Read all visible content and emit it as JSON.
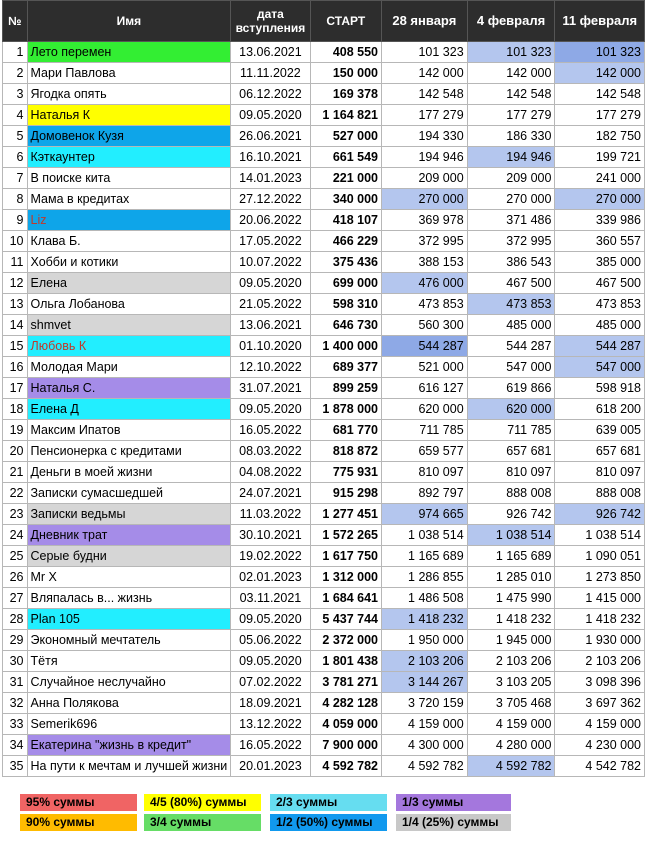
{
  "colors": {
    "green": "#33ee33",
    "yellow": "#ffff00",
    "blue": "#0ea5e9",
    "cyan": "#22eeff",
    "purple": "#a58ce8",
    "gray": "#d6d6d6",
    "lightblue": "#b4c6ee",
    "midblue": "#8ea9e6",
    "red": "#f06464",
    "orange": "#ffbb00",
    "legendgreen": "#66dd66",
    "legendcyan": "#66ddf0",
    "legendblue": "#1199ee",
    "legendpurple": "#a477dd",
    "legendgray": "#c8c8c8"
  },
  "headers": {
    "num": "№",
    "name": "Имя",
    "date": "дата вступления",
    "start": "СТАРТ",
    "w1": "28 января",
    "w2": "4 февраля",
    "w3": "11 февраля"
  },
  "rows": [
    {
      "n": "1",
      "name": "Лето перемен",
      "date": "13.06.2021",
      "start": "408 550",
      "w1": "101 323",
      "w2": "101 323",
      "w3": "101 323",
      "nc": "green",
      "c2": "lightblue",
      "c3": "midblue"
    },
    {
      "n": "2",
      "name": "Мари Павлова",
      "date": "11.11.2022",
      "start": "150 000",
      "w1": "142 000",
      "w2": "142 000",
      "w3": "142 000",
      "c3": "lightblue"
    },
    {
      "n": "3",
      "name": "Ягодка опять",
      "date": "06.12.2022",
      "start": "169 378",
      "w1": "142 548",
      "w2": "142 548",
      "w3": "142 548"
    },
    {
      "n": "4",
      "name": "Наталья К",
      "date": "09.05.2020",
      "start": "1 164 821",
      "w1": "177 279",
      "w2": "177 279",
      "w3": "177 279",
      "nc": "yellow"
    },
    {
      "n": "5",
      "name": "Домовенок Кузя",
      "date": "26.06.2021",
      "start": "527 000",
      "w1": "194 330",
      "w2": "186 330",
      "w3": "182 750",
      "nc": "blue"
    },
    {
      "n": "6",
      "name": "Кэткаунтер",
      "date": "16.10.2021",
      "start": "661 549",
      "w1": "194 946",
      "w2": "194 946",
      "w3": "199 721",
      "nc": "cyan",
      "c2": "lightblue"
    },
    {
      "n": "7",
      "name": "В поиске кита",
      "date": "14.01.2023",
      "start": "221 000",
      "w1": "209 000",
      "w2": "209 000",
      "w3": "241 000"
    },
    {
      "n": "8",
      "name": "Мама в кредитах",
      "date": "27.12.2022",
      "start": "340 000",
      "w1": "270 000",
      "w2": "270 000",
      "w3": "270 000",
      "c1": "lightblue",
      "c3": "lightblue"
    },
    {
      "n": "9",
      "name": "Liz",
      "date": "20.06.2022",
      "start": "418 107",
      "w1": "369 978",
      "w2": "371 486",
      "w3": "339 986",
      "nc": "blue",
      "ntext": "#c0392b"
    },
    {
      "n": "10",
      "name": "Клава Б.",
      "date": "17.05.2022",
      "start": "466 229",
      "w1": "372 995",
      "w2": "372 995",
      "w3": "360 557"
    },
    {
      "n": "11",
      "name": "Хобби и котики",
      "date": "10.07.2022",
      "start": "375 436",
      "w1": "388 153",
      "w2": "386 543",
      "w3": "385 000"
    },
    {
      "n": "12",
      "name": "Елена",
      "date": "09.05.2020",
      "start": "699 000",
      "w1": "476 000",
      "w2": "467 500",
      "w3": "467 500",
      "nc": "gray",
      "c1": "lightblue"
    },
    {
      "n": "13",
      "name": "Ольга Лобанова",
      "date": "21.05.2022",
      "start": "598 310",
      "w1": "473 853",
      "w2": "473 853",
      "w3": "473 853",
      "c2": "lightblue"
    },
    {
      "n": "14",
      "name": "shmvet",
      "date": "13.06.2021",
      "start": "646 730",
      "w1": "560 300",
      "w2": "485 000",
      "w3": "485 000",
      "nc": "gray"
    },
    {
      "n": "15",
      "name": "Любовь К",
      "date": "01.10.2020",
      "start": "1 400 000",
      "w1": "544 287",
      "w2": "544 287",
      "w3": "544 287",
      "nc": "cyan",
      "ntext": "#c0392b",
      "c1": "midblue",
      "c3": "lightblue"
    },
    {
      "n": "16",
      "name": "Молодая Мари",
      "date": "12.10.2022",
      "start": "689 377",
      "w1": "521 000",
      "w2": "547 000",
      "w3": "547 000",
      "c3": "lightblue"
    },
    {
      "n": "17",
      "name": "Наталья С.",
      "date": "31.07.2021",
      "start": "899 259",
      "w1": "616 127",
      "w2": "619 866",
      "w3": "598 918",
      "nc": "purple"
    },
    {
      "n": "18",
      "name": "Елена Д",
      "date": "09.05.2020",
      "start": "1 878 000",
      "w1": "620 000",
      "w2": "620 000",
      "w3": "618 200",
      "nc": "cyan",
      "c2": "lightblue"
    },
    {
      "n": "19",
      "name": "Максим Ипатов",
      "date": "16.05.2022",
      "start": "681 770",
      "w1": "711 785",
      "w2": "711 785",
      "w3": "639 005"
    },
    {
      "n": "20",
      "name": "Пенсионерка с кредитами",
      "date": "08.03.2022",
      "start": "818 872",
      "w1": "659 577",
      "w2": "657 681",
      "w3": "657 681"
    },
    {
      "n": "21",
      "name": "Деньги в моей жизни",
      "date": "04.08.2022",
      "start": "775 931",
      "w1": "810 097",
      "w2": "810 097",
      "w3": "810 097"
    },
    {
      "n": "22",
      "name": "Записки сумасшедшей",
      "date": "24.07.2021",
      "start": "915 298",
      "w1": "892 797",
      "w2": "888 008",
      "w3": "888 008"
    },
    {
      "n": "23",
      "name": "Записки ведьмы",
      "date": "11.03.2022",
      "start": "1 277 451",
      "w1": "974 665",
      "w2": "926 742",
      "w3": "926 742",
      "nc": "gray",
      "c1": "lightblue",
      "c3": "lightblue"
    },
    {
      "n": "24",
      "name": "Дневник трат",
      "date": "30.10.2021",
      "start": "1 572 265",
      "w1": "1 038 514",
      "w2": "1 038 514",
      "w3": "1 038 514",
      "nc": "purple",
      "c2": "lightblue"
    },
    {
      "n": "25",
      "name": "Серые будни",
      "date": "19.02.2022",
      "start": "1 617 750",
      "w1": "1 165 689",
      "w2": "1 165 689",
      "w3": "1 090 051",
      "nc": "gray"
    },
    {
      "n": "26",
      "name": "Mr X",
      "date": "02.01.2023",
      "start": "1 312 000",
      "w1": "1 286 855",
      "w2": "1 285 010",
      "w3": "1 273 850"
    },
    {
      "n": "27",
      "name": "Вляпалась в... жизнь",
      "date": "03.11.2021",
      "start": "1 684 641",
      "w1": "1 486 508",
      "w2": "1 475 990",
      "w3": "1 415 000"
    },
    {
      "n": "28",
      "name": "Plan 105",
      "date": "09.05.2020",
      "start": "5 437 744",
      "w1": "1 418 232",
      "w2": "1 418 232",
      "w3": "1 418 232",
      "nc": "cyan",
      "c1": "lightblue"
    },
    {
      "n": "29",
      "name": "Экономный мечтатель",
      "date": "05.06.2022",
      "start": "2 372 000",
      "w1": "1 950 000",
      "w2": "1 945 000",
      "w3": "1 930 000"
    },
    {
      "n": "30",
      "name": "Тётя",
      "date": "09.05.2020",
      "start": "1 801 438",
      "w1": "2 103 206",
      "w2": "2 103 206",
      "w3": "2 103 206",
      "c1": "lightblue"
    },
    {
      "n": "31",
      "name": "Случайное неслучайно",
      "date": "07.02.2022",
      "start": "3 781 271",
      "w1": "3 144 267",
      "w2": "3 103 205",
      "w3": "3 098 396",
      "c1": "lightblue"
    },
    {
      "n": "32",
      "name": "Анна Полякова",
      "date": "18.09.2021",
      "start": "4 282 128",
      "w1": "3 720 159",
      "w2": "3 705 468",
      "w3": "3 697 362"
    },
    {
      "n": "33",
      "name": "Semerik696",
      "date": "13.12.2022",
      "start": "4 059 000",
      "w1": "4 159 000",
      "w2": "4 159 000",
      "w3": "4 159 000"
    },
    {
      "n": "34",
      "name": "Екатерина \"жизнь в кредит\"",
      "date": "16.05.2022",
      "start": "7 900 000",
      "w1": "4 300 000",
      "w2": "4 280 000",
      "w3": "4 230 000",
      "nc": "purple"
    },
    {
      "n": "35",
      "name": "На пути к мечтам и лучшей жизни",
      "date": "20.01.2023",
      "start": "4 592 782",
      "w1": "4 592 782",
      "w2": "4 592 782",
      "w3": "4 542 782",
      "c2": "lightblue"
    }
  ],
  "legend": [
    {
      "label": "95% суммы",
      "color": "red"
    },
    {
      "label": "90% суммы",
      "color": "orange"
    },
    {
      "label": "4/5 (80%) суммы",
      "color": "yellow"
    },
    {
      "label": "3/4 суммы",
      "color": "legendgreen"
    },
    {
      "label": "2/3 суммы",
      "color": "legendcyan"
    },
    {
      "label": "1/2 (50%) суммы",
      "color": "legendblue"
    },
    {
      "label": "1/3 суммы",
      "color": "legendpurple"
    },
    {
      "label": "1/4 (25%) суммы",
      "color": "legendgray"
    }
  ]
}
